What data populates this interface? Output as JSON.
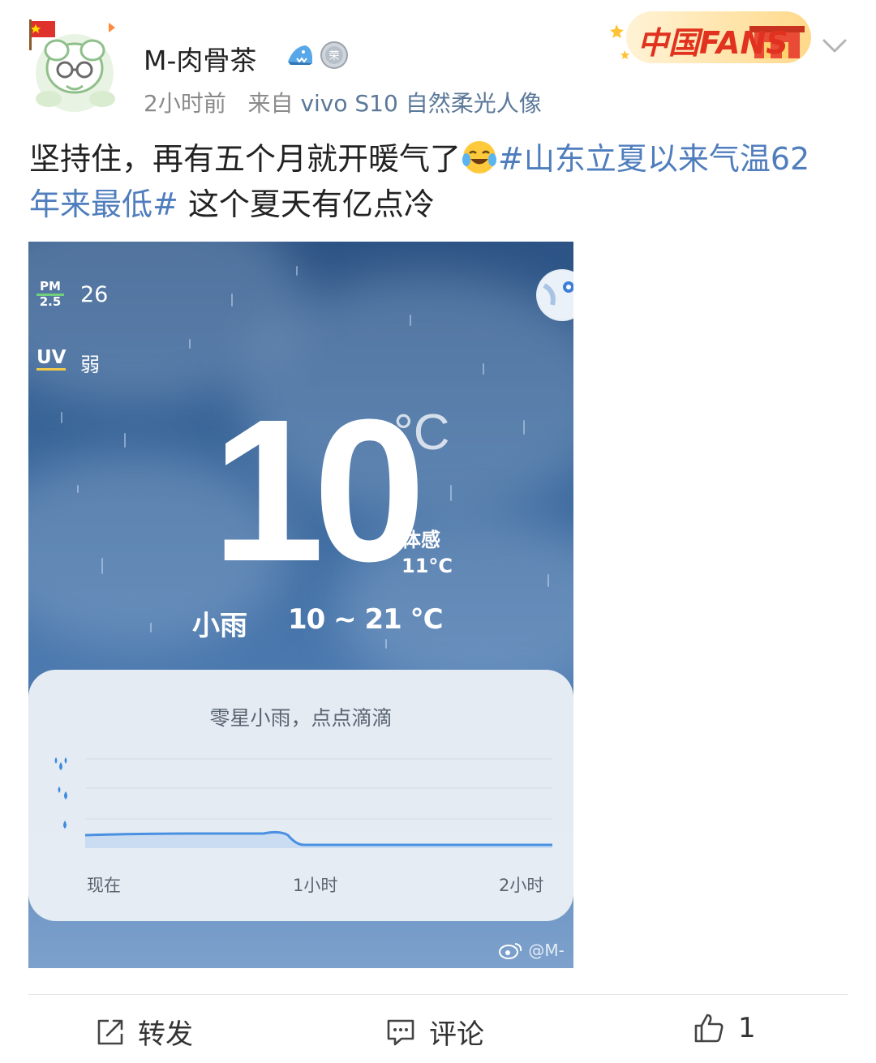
{
  "header": {
    "username": "M-肉骨茶",
    "time": "2小时前",
    "source_prefix": "来自",
    "device": "vivo S10 自然柔光人像",
    "fans_banner": "中国FANS"
  },
  "post": {
    "text_before": "坚持住，再有五个月就开暖气了",
    "hashtag": "#山东立夏以来气温62年来最低#",
    "text_after": " 这个夏天有亿点冷"
  },
  "weather": {
    "pm_label_top": "PM",
    "pm_label_bottom": "2.5",
    "pm_value": "26",
    "uv_label": "UV",
    "uv_value": "弱",
    "temperature": "10",
    "temp_unit": "°C",
    "feels_label": "体感",
    "feels_value": "11°C",
    "condition": "小雨",
    "range": "10 ~ 21 °C",
    "summary": "零星小雨，点点滴滴",
    "x_labels": [
      "现在",
      "1小时",
      "2小时"
    ],
    "watermark": "@M-",
    "colors": {
      "sky_top": "#2c5384",
      "sky_bottom": "#7da1cc",
      "rain_line": "#4a90e2"
    }
  },
  "actions": {
    "repost_label": "转发",
    "comment_label": "评论",
    "like_count": "1"
  }
}
